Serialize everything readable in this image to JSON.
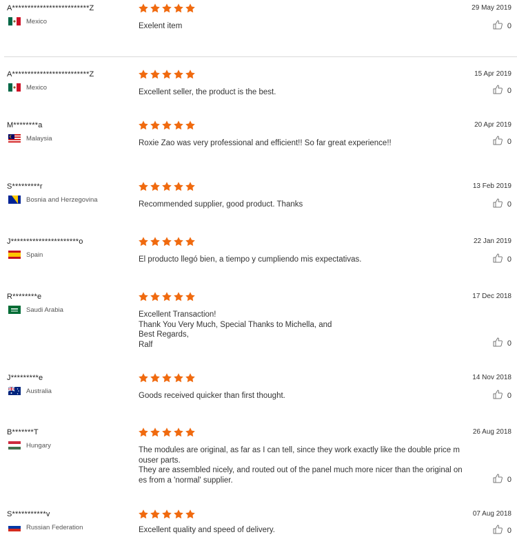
{
  "reviews": [
    {
      "user": "A*************************Z",
      "country": "Mexico",
      "flag": "mx",
      "date": "29 May 2019",
      "lines": [
        "Exelent item"
      ],
      "likes": "0"
    },
    {
      "user": "A*************************Z",
      "country": "Mexico",
      "flag": "mx",
      "date": "15 Apr 2019",
      "lines": [
        "Excellent seller, the product is the best."
      ],
      "likes": "0"
    },
    {
      "user": "M********a",
      "country": "Malaysia",
      "flag": "my",
      "date": "20 Apr 2019",
      "lines": [
        "Roxie Zao was very professional and efficient!! So far great experience!!"
      ],
      "likes": "0"
    },
    {
      "user": "S*********r",
      "country": "Bosnia and Herzegovina",
      "flag": "ba",
      "date": "13 Feb 2019",
      "lines": [
        "Recommended supplier, good product. Thanks"
      ],
      "likes": "0"
    },
    {
      "user": "J**********************o",
      "country": "Spain",
      "flag": "es",
      "date": "22 Jan 2019",
      "lines": [
        "El producto llegó bien, a tiempo y cumpliendo mis expectativas."
      ],
      "likes": "0"
    },
    {
      "user": "R********e",
      "country": "Saudi Arabia",
      "flag": "sa",
      "date": "17 Dec 2018",
      "lines": [
        "Excellent Transaction!",
        "Thank You Very Much, Special Thanks to Michella, and",
        "Best Regards,",
        "Ralf"
      ],
      "likes": "0"
    },
    {
      "user": "J*********e",
      "country": "Australia",
      "flag": "au",
      "date": "14 Nov 2018",
      "lines": [
        "Goods received quicker than first thought."
      ],
      "likes": "0"
    },
    {
      "user": "B*******T",
      "country": "Hungary",
      "flag": "hu",
      "date": "26 Aug 2018",
      "lines": [
        "The modules are original, as far as I can tell, since they work exactly like the double price m",
        "ouser parts.",
        "They are assembled nicely, and routed out of the panel much more nicer than the original on",
        "es from a 'normal' supplier."
      ],
      "likes": "0"
    },
    {
      "user": "S***********v",
      "country": "Russian Federation",
      "flag": "ru",
      "date": "07 Aug 2018",
      "lines": [
        "Excellent quality and speed of delivery."
      ],
      "likes": "0"
    }
  ],
  "star_color": "#f06a0f",
  "rating_stars": 5
}
